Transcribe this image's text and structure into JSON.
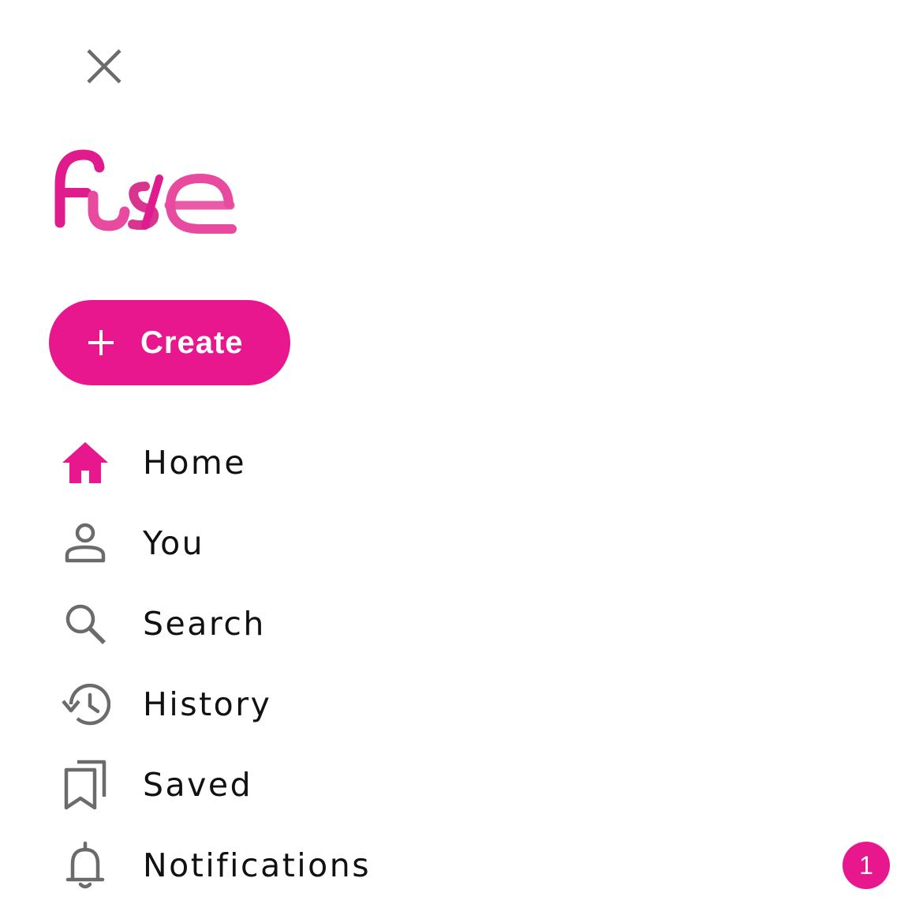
{
  "brand": {
    "logo_text": "fuse",
    "accent": "#e8178d"
  },
  "header": {
    "close_icon": "close-icon"
  },
  "create_button": {
    "label": "Create",
    "icon": "plus-icon"
  },
  "nav": {
    "items": [
      {
        "label": "Home",
        "icon": "home-icon",
        "active": true
      },
      {
        "label": "You",
        "icon": "person-icon"
      },
      {
        "label": "Search",
        "icon": "search-icon"
      },
      {
        "label": "History",
        "icon": "history-icon"
      },
      {
        "label": "Saved",
        "icon": "bookmarks-icon"
      },
      {
        "label": "Notifications",
        "icon": "bell-icon",
        "badge": "1"
      }
    ]
  }
}
